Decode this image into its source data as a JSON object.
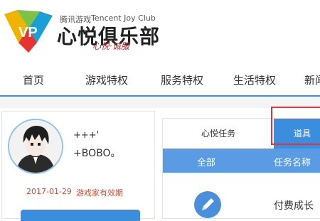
{
  "brand": {
    "cn_small": "腾讯游戏",
    "en": "Tencent Joy Club",
    "cn_big": "心悦俱乐部",
    "slogan": "心悦·诚服"
  },
  "nav": {
    "items": [
      {
        "label": "首页"
      },
      {
        "label": "游戏特权"
      },
      {
        "label": "服务特权"
      },
      {
        "label": "生活特权"
      },
      {
        "label": "新闻"
      }
    ]
  },
  "profile": {
    "line1": "+++'",
    "line2": "+BOBO。",
    "date": "2017-01-29",
    "expire_label": "游戏家有效期"
  },
  "panel": {
    "tabs": [
      {
        "label": "心悦任务"
      },
      {
        "label": "道具"
      }
    ],
    "columns": [
      "全部",
      "任务名称"
    ],
    "rows": [
      {
        "icon": "pencil-icon",
        "name": "付费成长"
      }
    ]
  },
  "colors": {
    "accent": "#3b8ede",
    "table_header": "#5a9be4",
    "highlight_border": "#e0353b",
    "date_text": "#d94a2b"
  }
}
